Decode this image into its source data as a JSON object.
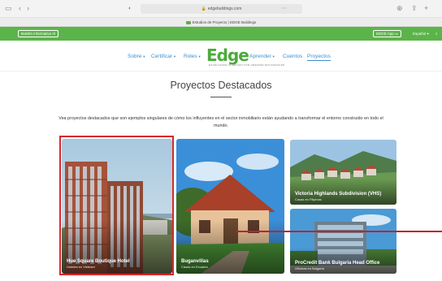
{
  "browser": {
    "url": "edgebuildings.com",
    "tab_title": "Estudios de Proyecto | EDGE Buildings"
  },
  "topbar": {
    "newsletter_label": "Boletín informativo",
    "app_label": "EDGE App",
    "language_label": "Español"
  },
  "nav": {
    "items": [
      {
        "label": "Sobre",
        "has_caret": true
      },
      {
        "label": "Certificar",
        "has_caret": true
      },
      {
        "label": "Roles",
        "has_caret": true
      },
      {
        "label": "Aprender",
        "has_caret": true
      },
      {
        "label": "Cuentos",
        "has_caret": false
      },
      {
        "label": "Proyectos",
        "has_caret": false
      }
    ],
    "logo_text": "Edge",
    "logo_sub": "EXCELLENCE IN DESIGN FOR GREATER EFFICIENCIES"
  },
  "main": {
    "title": "Proyectos Destacados",
    "lead": "Vea proyectos destacados que son ejemplos singulares de cómo los influyentes en el sector inmobiliario están ayudando a transformar el entorno construido en todo el mundo.",
    "projects": [
      {
        "name": "Hue Square Boutique Hotel",
        "subtitle": "Hoteles en Vietnam"
      },
      {
        "name": "Buganvillas",
        "subtitle": "Casas en Ecuador"
      },
      {
        "name": "Victoria Highlands Subdivision (VHS)",
        "subtitle": "Casas en Filipinas"
      },
      {
        "name": "ProCredit Bank Bulgaria Head Office",
        "subtitle": "Oficinas en Bulgaria"
      }
    ]
  },
  "colors": {
    "brand_green": "#5bb44a",
    "nav_blue": "#3a8fd0",
    "highlight_red": "#d8282c"
  }
}
